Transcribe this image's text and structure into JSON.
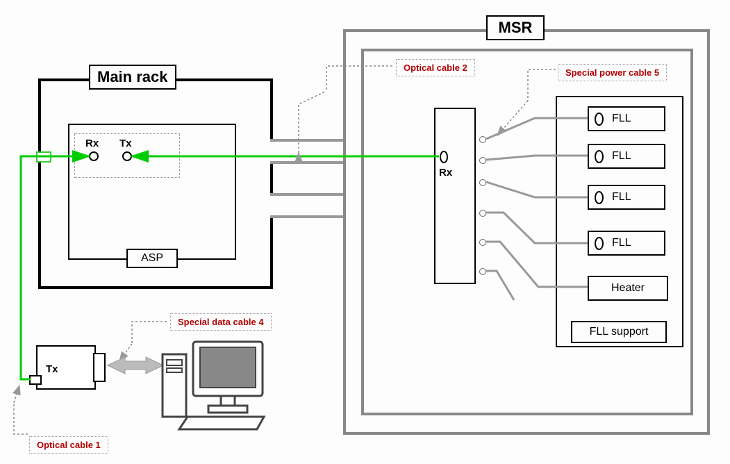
{
  "diagram": {
    "main_rack": {
      "title": "Main rack",
      "rx": "Rx",
      "tx": "Tx",
      "asp": "ASP"
    },
    "msr": {
      "title": "MSR",
      "rx": "Rx",
      "fll": "FLL",
      "heater": "Heater",
      "fll_support": "FLL support"
    },
    "tx_module": {
      "tx": "Tx"
    },
    "cables": {
      "optical1": "Optical cable 1",
      "optical2": "Optical cable 2",
      "special4": "Special data cable 4",
      "special5": "Special power cable 5"
    }
  }
}
